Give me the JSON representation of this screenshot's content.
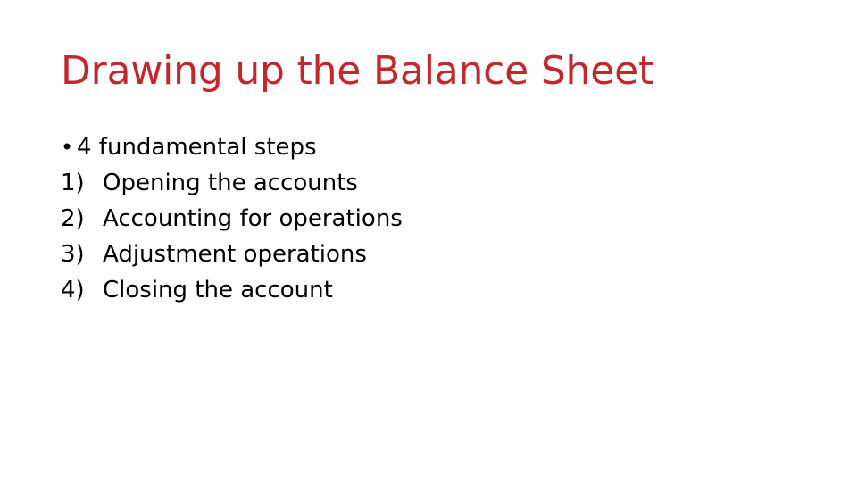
{
  "slide": {
    "title": "Drawing up the Balance Sheet",
    "title_color": "#C1272D",
    "background_color": "#FFFFFF",
    "body_text_color": "#000000",
    "bullet": {
      "marker": "•",
      "text": "4 fundamental steps"
    },
    "numbered_items": [
      {
        "marker": "1)",
        "text": "Opening the accounts"
      },
      {
        "marker": "2)",
        "text": "Accounting for operations"
      },
      {
        "marker": "3)",
        "text": "Adjustment operations"
      },
      {
        "marker": "4)",
        "text": "Closing the account"
      }
    ]
  }
}
